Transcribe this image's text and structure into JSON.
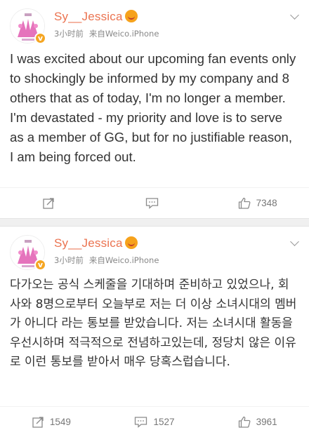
{
  "posts": [
    {
      "username": "Sy__Jessica",
      "time": "3小时前",
      "source": "来自Weico.iPhone",
      "text": "I was excited about our upcoming fan events only to shockingly be informed by my company and 8 others that as of today, I'm no longer a member. I'm devastated - my priority and love is to serve as a member of GG, but for no justifiable reason, I am being forced out.",
      "repost_count": "",
      "comment_count": "",
      "like_count": "7348"
    },
    {
      "username": "Sy__Jessica",
      "time": "3小时前",
      "source": "来自Weico.iPhone",
      "text": "다가오는 공식 스케줄을 기대하며 준비하고 있었으나, 회사와 8명으로부터 오늘부로 저는 더 이상 소녀시대의 멤버가 아니다 라는 통보를 받았습니다. 저는 소녀시대 활동을 우선시하며 적극적으로 전념하고있는데, 정당치 않은 이유로 이런 통보를 받아서 매우 당혹스럽습니다.",
      "repost_count": "1549",
      "comment_count": "1527",
      "like_count": "3961"
    }
  ],
  "icons": {
    "repost": "repost-icon",
    "comment": "comment-icon",
    "like": "like-icon",
    "verified": "verified-icon",
    "badge": "vip-badge-icon",
    "menu": "chevron-down-icon"
  },
  "colors": {
    "username": "#eb7350",
    "meta": "#888888",
    "verified": "#f5a623"
  }
}
